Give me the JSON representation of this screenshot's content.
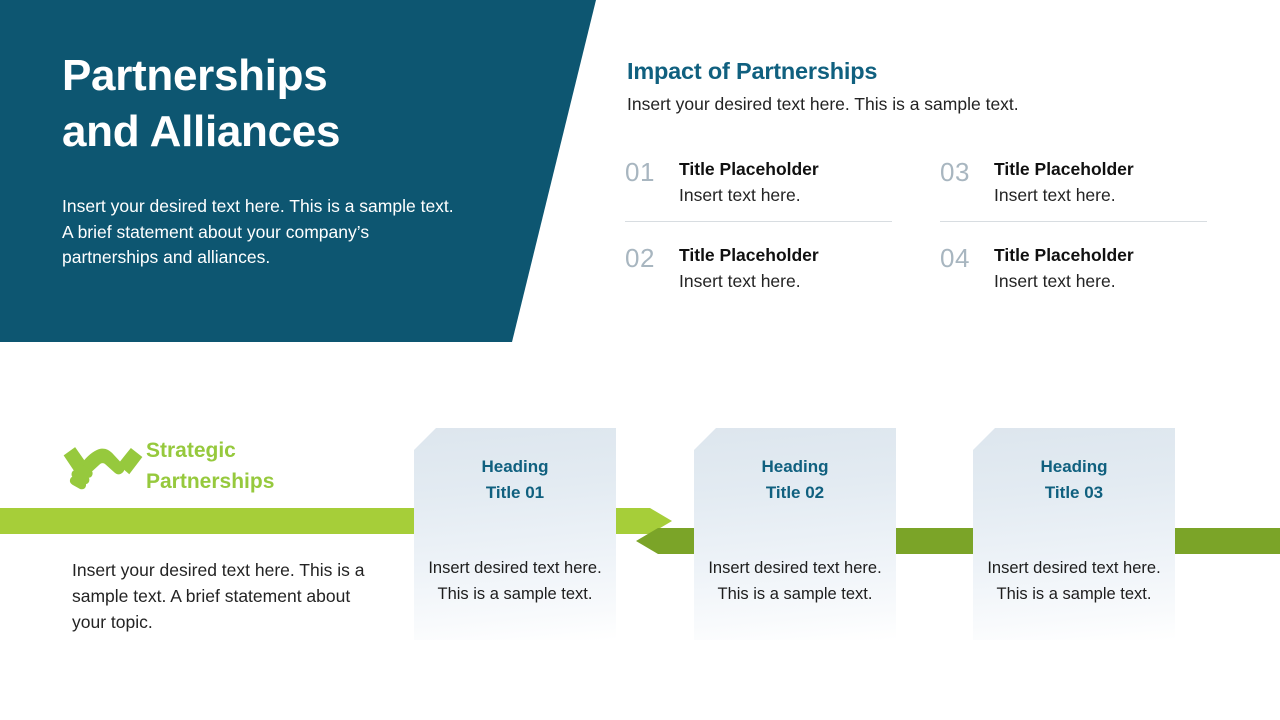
{
  "hero": {
    "title": "Partnerships\nand Alliances",
    "subtitle": "Insert your desired text here. This is a sample text. A brief statement about your company’s partnerships and alliances.",
    "background_color": "#0d5671"
  },
  "impact": {
    "title": "Impact of Partnerships",
    "subtitle": "Insert your desired text here. This is a sample text.",
    "title_color": "#10607f",
    "items": [
      {
        "number": "01",
        "title": "Title Placeholder",
        "description": "Insert text here."
      },
      {
        "number": "02",
        "title": "Title Placeholder",
        "description": "Insert text here."
      },
      {
        "number": "03",
        "title": "Title Placeholder",
        "description": "Insert text here."
      },
      {
        "number": "04",
        "title": "Title Placeholder",
        "description": "Insert text here."
      }
    ]
  },
  "strategic": {
    "icon": "handshake-icon",
    "label": "Strategic\nPartnerships",
    "label_color": "#96c93d",
    "text": "Insert your desired text here. This is a sample text. A brief statement about your topic."
  },
  "bands": {
    "light_color": "#a6ce39",
    "dark_color": "#7ba428"
  },
  "cards": [
    {
      "heading": "Heading\nTitle 01",
      "body": "Insert desired text here. This is a sample text."
    },
    {
      "heading": "Heading\nTitle 02",
      "body": "Insert desired text here. This is a sample text."
    },
    {
      "heading": "Heading\nTitle 03",
      "body": "Insert desired text here. This is a sample text."
    }
  ]
}
